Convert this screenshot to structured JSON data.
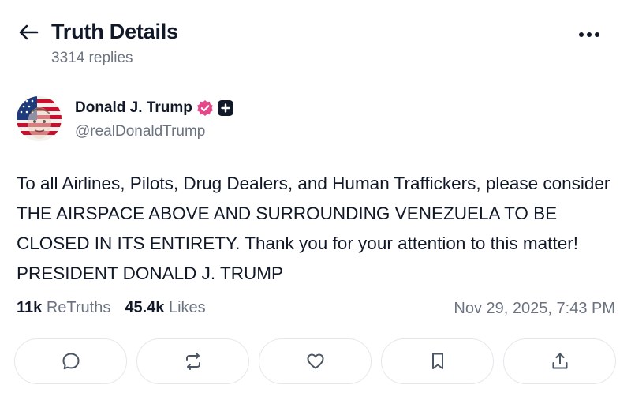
{
  "header": {
    "title": "Truth Details",
    "replies": "3314 replies"
  },
  "author": {
    "name": "Donald J. Trump",
    "handle": "@realDonaldTrump"
  },
  "post": {
    "text": "To all Airlines, Pilots, Drug Dealers, and Human Traffickers, please consider THE AIRSPACE ABOVE AND SURROUNDING VENEZUELA TO BE CLOSED IN ITS ENTIRETY. Thank you for your attention to this matter! PRESIDENT DONALD J. TRUMP"
  },
  "stats": {
    "retruths_count": "11k",
    "retruths_label": "ReTruths",
    "likes_count": "45.4k",
    "likes_label": "Likes",
    "timestamp": "Nov 29, 2025, 7:43 PM"
  },
  "icons": {
    "back": "arrow-left-icon",
    "more": "more-horizontal-icon",
    "verified": "verified-badge-icon",
    "plus": "plus-badge-icon",
    "reply": "reply-icon",
    "retruth": "repost-icon",
    "like": "heart-icon",
    "bookmark": "bookmark-icon",
    "share": "share-icon"
  },
  "colors": {
    "verified_badge": "#e5488a",
    "muted_text": "#6b7280",
    "primary_text": "#111827",
    "border": "#e5e7eb"
  }
}
